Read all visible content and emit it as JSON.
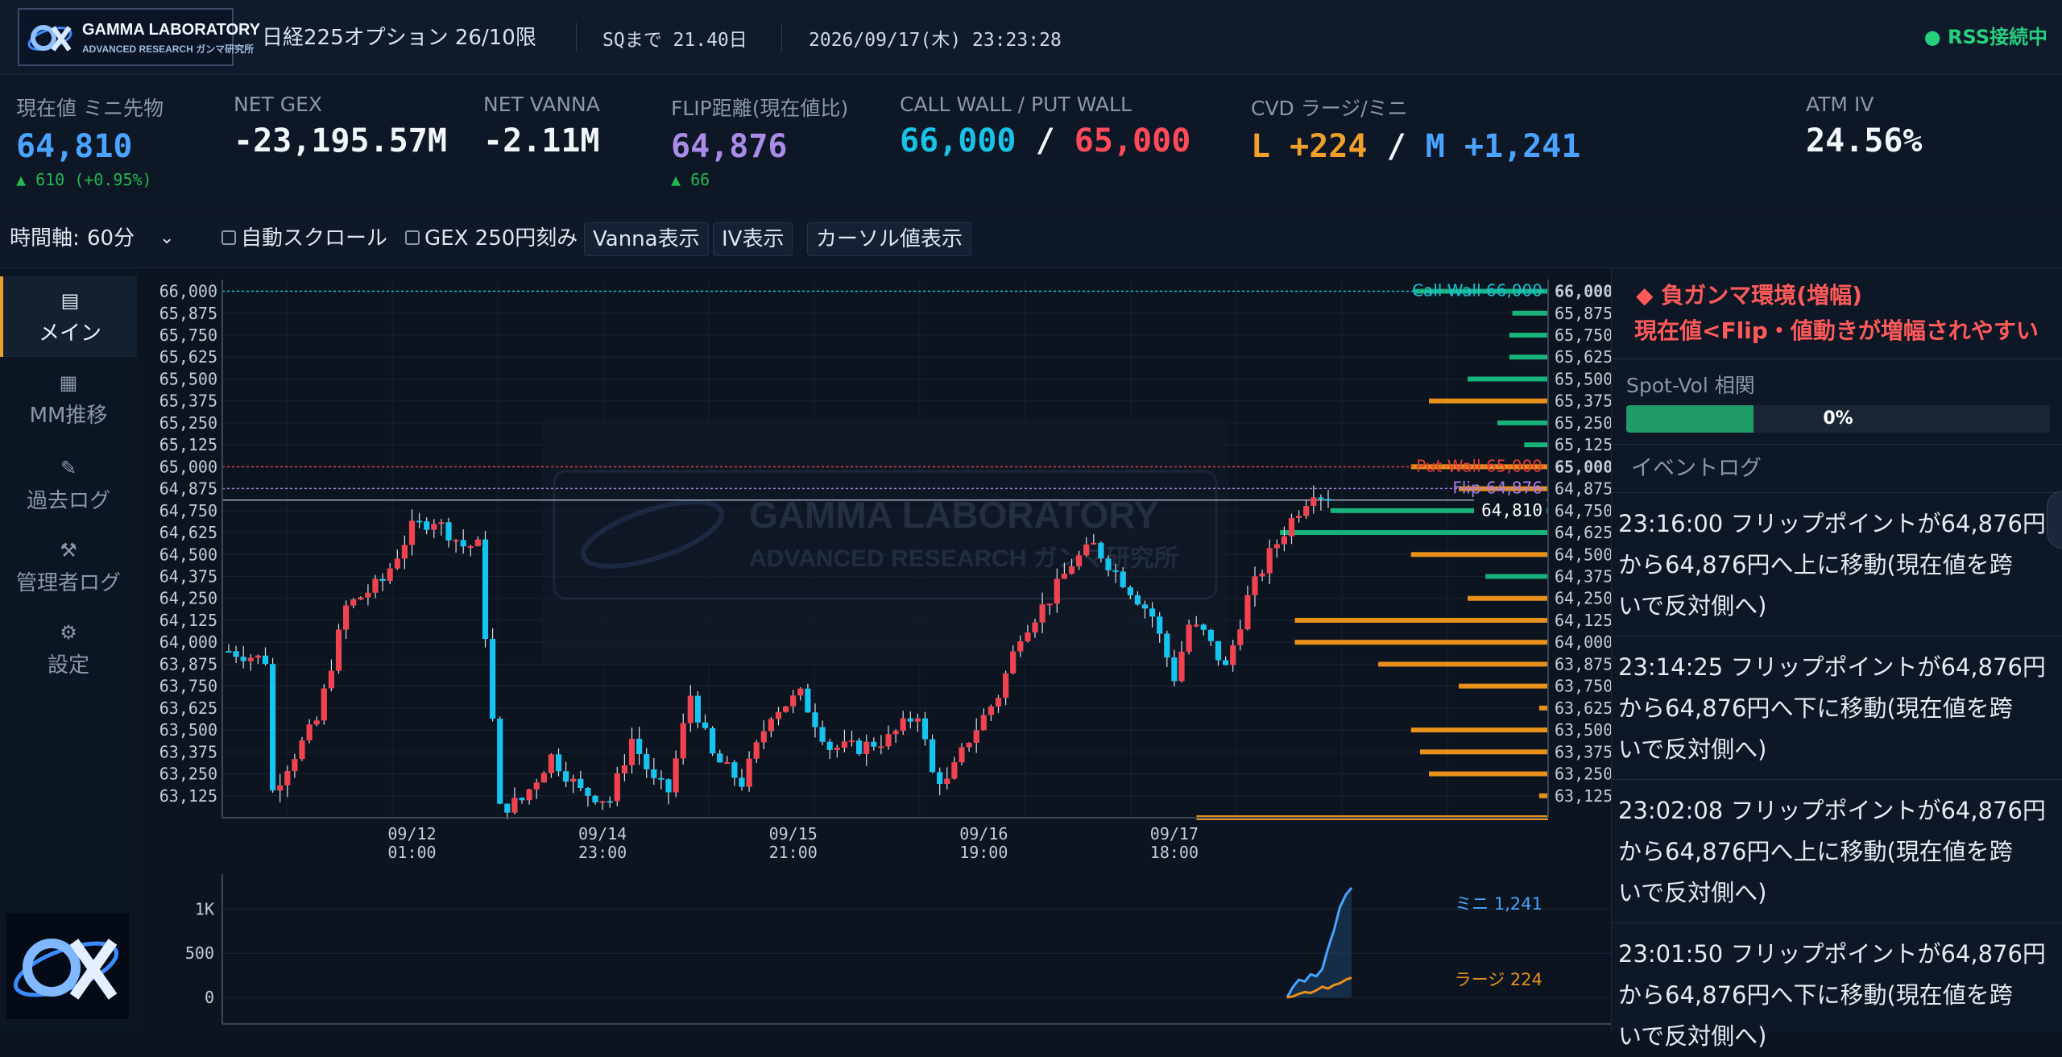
{
  "header": {
    "logo_title": "GAMMA LABORATORY",
    "logo_subtitle": "ADVANCED RESEARCH ガンマ研究所",
    "instrument": "日経225オプション 26/10限",
    "sq_countdown": "SQまで 21.40日",
    "datetime": "2026/09/17(木) 23:23:28",
    "connection_status": "● RSS接続中"
  },
  "metrics": {
    "price": {
      "label": "現在値 ミニ先物",
      "value": "64,810",
      "change": "▲ 610 (+0.95%)"
    },
    "net_gex": {
      "label": "NET GEX",
      "value": "-23,195.57M"
    },
    "net_vanna": {
      "label": "NET VANNA",
      "value": "-2.11M"
    },
    "flip": {
      "label": "FLIP距離(現在値比)",
      "value": "64,876",
      "change": "▲ 66"
    },
    "walls": {
      "label": "CALL WALL / PUT WALL",
      "call": "66,000",
      "sep": "/",
      "put": "65,000"
    },
    "cvd": {
      "label": "CVD ラージ/ミニ",
      "large": "L +224",
      "sep": "/",
      "mini": "M +1,241"
    },
    "atm_iv": {
      "label": "ATM IV",
      "value": "24.56%"
    }
  },
  "controls": {
    "timeframe_label": "時間軸:",
    "timeframe_value": "60分",
    "auto_scroll": "自動スクロール",
    "gex_step": "GEX 250円刻み",
    "vanna_btn": "Vanna表示",
    "iv_btn": "IV表示",
    "cursor_btn": "カーソル値表示"
  },
  "nav": [
    {
      "label": "メイン",
      "icon": "list-icon",
      "glyph": "▤"
    },
    {
      "label": "MM推移",
      "icon": "grid-icon",
      "glyph": "▦"
    },
    {
      "label": "過去ログ",
      "icon": "pencil-icon",
      "glyph": "✎"
    },
    {
      "label": "管理者ログ",
      "icon": "tools-icon",
      "glyph": "⚒"
    },
    {
      "label": "設定",
      "icon": "gear-icon",
      "glyph": "⚙"
    }
  ],
  "right_panel": {
    "alert_title": "◆ 負ガンマ環境(増幅)",
    "alert_sub": "現在値<Flip・値動きが増幅されやすい",
    "spot_vol_label": "Spot-Vol 相関",
    "spot_vol_value": 0,
    "spot_vol_text": "0%",
    "event_log_title": "イベントログ",
    "events": [
      {
        "line1": "23:16:00 フリップポイントが64,876円",
        "line2": "から64,876円へ上に移動(現在値を跨",
        "line3": "いで反対側へ)"
      },
      {
        "line1": "23:14:25 フリップポイントが64,876円",
        "line2": "から64,876円へ下に移動(現在値を跨",
        "line3": "いで反対側へ)"
      },
      {
        "line1": "23:02:08 フリップポイントが64,876円",
        "line2": "から64,876円へ上に移動(現在値を跨",
        "line3": "いで反対側へ)"
      },
      {
        "line1": "23:01:50 フリップポイントが64,876円",
        "line2": "から64,876円へ下に移動(現在値を跨",
        "line3": "いで反対側へ)"
      }
    ]
  },
  "colors": {
    "up": "#f0434f",
    "down": "#16c4f0",
    "gex_pos": "#18b37a",
    "gex_neg": "#e8901a",
    "call_wall": "#19c2d6",
    "put_wall": "#e83a3a",
    "flip": "#a87de0",
    "mini": "#4aa3ff",
    "large": "#e8901a"
  },
  "chart_data": {
    "type": "candlestick",
    "y_range": [
      63000,
      66030
    ],
    "y_ticks": [
      "66,000",
      "65,875",
      "65,750",
      "65,625",
      "65,500",
      "65,375",
      "65,250",
      "65,125",
      "65,000",
      "64,875",
      "64,750",
      "64,625",
      "64,500",
      "64,375",
      "64,250",
      "64,125",
      "64,000",
      "63,875",
      "63,750",
      "63,625",
      "63,500",
      "63,375",
      "63,250",
      "63,125"
    ],
    "x_labels": [
      {
        "date": "09/12",
        "time": "01:00",
        "idx": 25
      },
      {
        "date": "09/14",
        "time": "23:00",
        "idx": 51
      },
      {
        "date": "09/15",
        "time": "21:00",
        "idx": 77
      },
      {
        "date": "09/16",
        "time": "19:00",
        "idx": 103
      },
      {
        "date": "09/17",
        "time": "18:00",
        "idx": 129
      }
    ],
    "anchors": [
      [
        0,
        63950
      ],
      [
        5,
        63900
      ],
      [
        6,
        63150
      ],
      [
        8,
        63300
      ],
      [
        12,
        63550
      ],
      [
        16,
        64200
      ],
      [
        21,
        64350
      ],
      [
        25,
        64650
      ],
      [
        28,
        64700
      ],
      [
        32,
        64550
      ],
      [
        34,
        64550
      ],
      [
        37,
        63050
      ],
      [
        40,
        63100
      ],
      [
        44,
        63350
      ],
      [
        48,
        63150
      ],
      [
        52,
        63100
      ],
      [
        55,
        63450
      ],
      [
        58,
        63200
      ],
      [
        60,
        63150
      ],
      [
        63,
        63700
      ],
      [
        66,
        63350
      ],
      [
        70,
        63200
      ],
      [
        74,
        63600
      ],
      [
        78,
        63700
      ],
      [
        82,
        63400
      ],
      [
        86,
        63400
      ],
      [
        90,
        63450
      ],
      [
        94,
        63600
      ],
      [
        96,
        63250
      ],
      [
        98,
        63200
      ],
      [
        101,
        63450
      ],
      [
        105,
        63700
      ],
      [
        108,
        64050
      ],
      [
        112,
        64250
      ],
      [
        115,
        64450
      ],
      [
        118,
        64550
      ],
      [
        122,
        64350
      ],
      [
        126,
        64150
      ],
      [
        129,
        63800
      ],
      [
        131,
        64100
      ],
      [
        133,
        64050
      ],
      [
        136,
        63850
      ],
      [
        139,
        64250
      ],
      [
        142,
        64500
      ],
      [
        145,
        64700
      ],
      [
        148,
        64870
      ],
      [
        150,
        64810
      ]
    ],
    "series": [
      {
        "name": "Call Wall 66,000",
        "value": 66000
      },
      {
        "name": "Put Wall 65,000",
        "value": 65000
      },
      {
        "name": "Flip 64,876",
        "value": 64876
      },
      {
        "name": "64,810",
        "value": 64810
      }
    ],
    "gex_bars": [
      [
        66000,
        0.45
      ],
      [
        65875,
        0.12
      ],
      [
        65750,
        0.13
      ],
      [
        65625,
        0.13
      ],
      [
        65500,
        0.27
      ],
      [
        65375,
        -0.4
      ],
      [
        65250,
        0.17
      ],
      [
        65125,
        0.08
      ],
      [
        65000,
        -0.46
      ],
      [
        64875,
        -0.3
      ],
      [
        64750,
        0.73
      ],
      [
        64625,
        0.9
      ],
      [
        64500,
        -0.46
      ],
      [
        64375,
        0.21
      ],
      [
        64250,
        -0.27
      ],
      [
        64125,
        -0.85
      ],
      [
        64000,
        -0.85
      ],
      [
        63875,
        -0.57
      ],
      [
        63750,
        -0.3
      ],
      [
        63625,
        -0.03
      ],
      [
        63500,
        -0.46
      ],
      [
        63375,
        -0.43
      ],
      [
        63250,
        -0.4
      ],
      [
        63125,
        -0.03
      ],
      [
        63000,
        -1.18
      ]
    ],
    "cvd": {
      "y_ticks": [
        "1K",
        "500",
        "0"
      ],
      "series": [
        {
          "name": "ミニ 1,241",
          "values": [
            0,
            120,
            200,
            180,
            260,
            240,
            320,
            560,
            760,
            1020,
            1160,
            1241
          ]
        },
        {
          "name": "ラージ 224",
          "values": [
            0,
            10,
            40,
            60,
            50,
            80,
            120,
            100,
            140,
            160,
            200,
            224
          ]
        }
      ]
    }
  }
}
